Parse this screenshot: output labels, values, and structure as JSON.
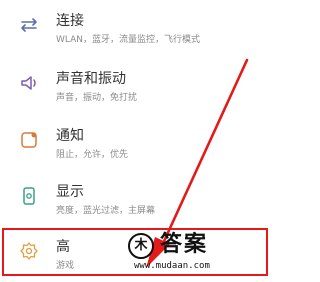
{
  "settings": {
    "items": [
      {
        "icon": "connection-icon",
        "title": "连接",
        "subtitle": "WLAN，蓝牙，流量监控，飞行模式"
      },
      {
        "icon": "sound-icon",
        "title": "声音和振动",
        "subtitle": "声音，振动，免打扰"
      },
      {
        "icon": "notification-icon",
        "title": "通知",
        "subtitle": "阻止，允许，优先"
      },
      {
        "icon": "display-icon",
        "title": "显示",
        "subtitle": "亮度，蓝光过滤，主屏幕"
      },
      {
        "icon": "advanced-features-icon",
        "title": "高",
        "subtitle": "游戏"
      }
    ]
  },
  "watermark": {
    "logo": "木",
    "title": "答案",
    "url": "www.mudaan.com"
  },
  "colors": {
    "accent": "#e31a1a",
    "icon": "#e06a3a"
  }
}
